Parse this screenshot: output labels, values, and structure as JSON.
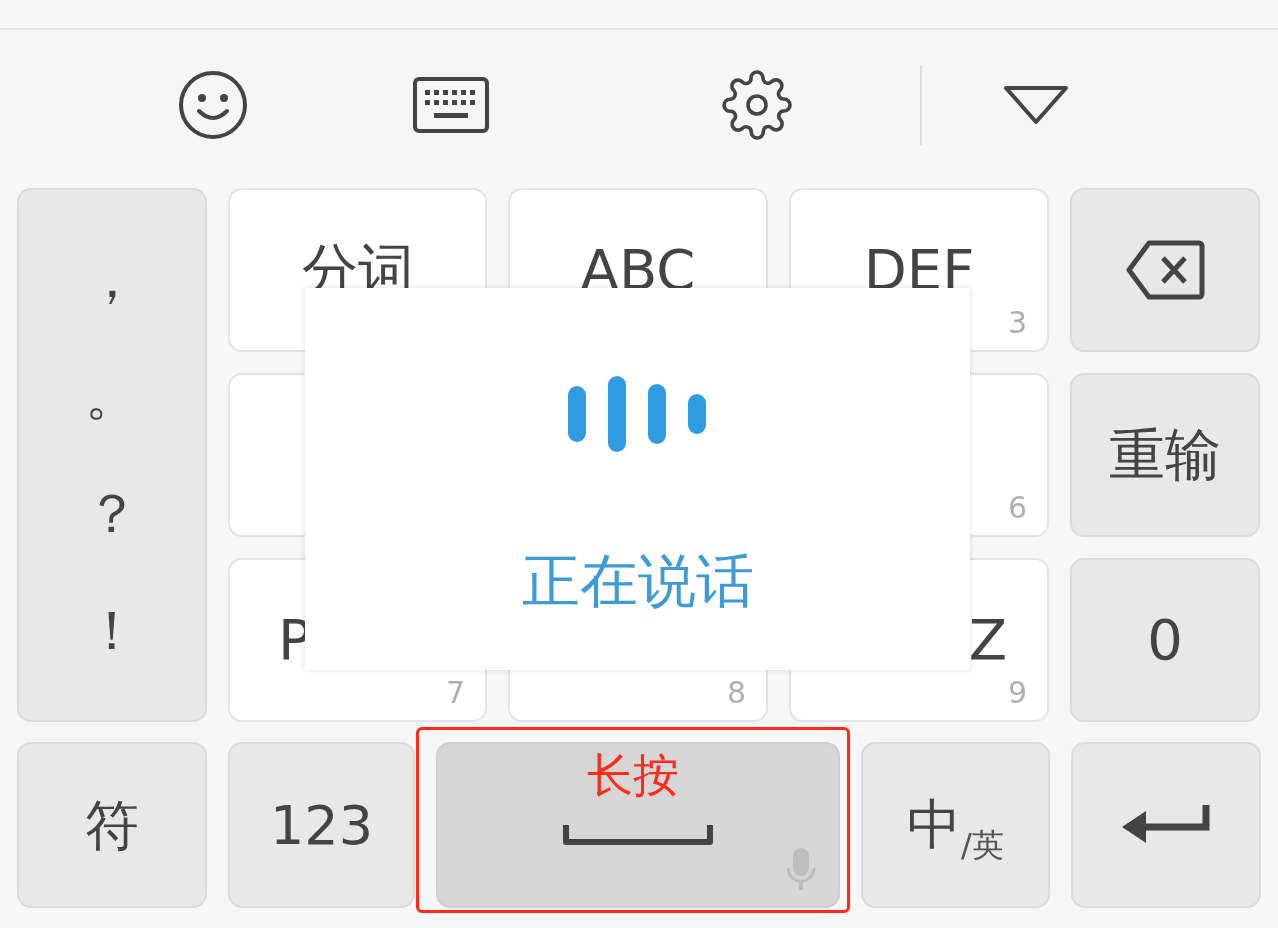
{
  "toolbar": {
    "buttons": [
      {
        "kind": "emoji"
      },
      {
        "kind": "keyboard"
      },
      {
        "kind": "settings"
      },
      {
        "kind": "collapse"
      }
    ]
  },
  "punctuation_key": {
    "symbols": [
      "，",
      "。",
      "？",
      "！"
    ]
  },
  "keys": [
    {
      "label": "分词"
    },
    {
      "label": "ABC"
    },
    {
      "label": "DEF",
      "digit": "3"
    },
    {
      "kind": "backspace"
    },
    {
      "digit": "6"
    },
    {
      "label": "重输",
      "kind": "function"
    },
    {
      "label": "P",
      "digit": "7"
    },
    {
      "digit": "8"
    },
    {
      "label": "Z",
      "digit": "9"
    },
    {
      "label": "0",
      "kind": "function"
    }
  ],
  "bottom_row": [
    {
      "kind": "function",
      "label": "符"
    },
    {
      "kind": "function",
      "label": "123"
    },
    {
      "kind": "space",
      "pressed": true
    },
    {
      "kind": "lang",
      "label": "中",
      "sub": "/英"
    },
    {
      "kind": "enter"
    }
  ],
  "voice_popup": {
    "status": "正在说话"
  },
  "annotation": {
    "label": "长按"
  }
}
